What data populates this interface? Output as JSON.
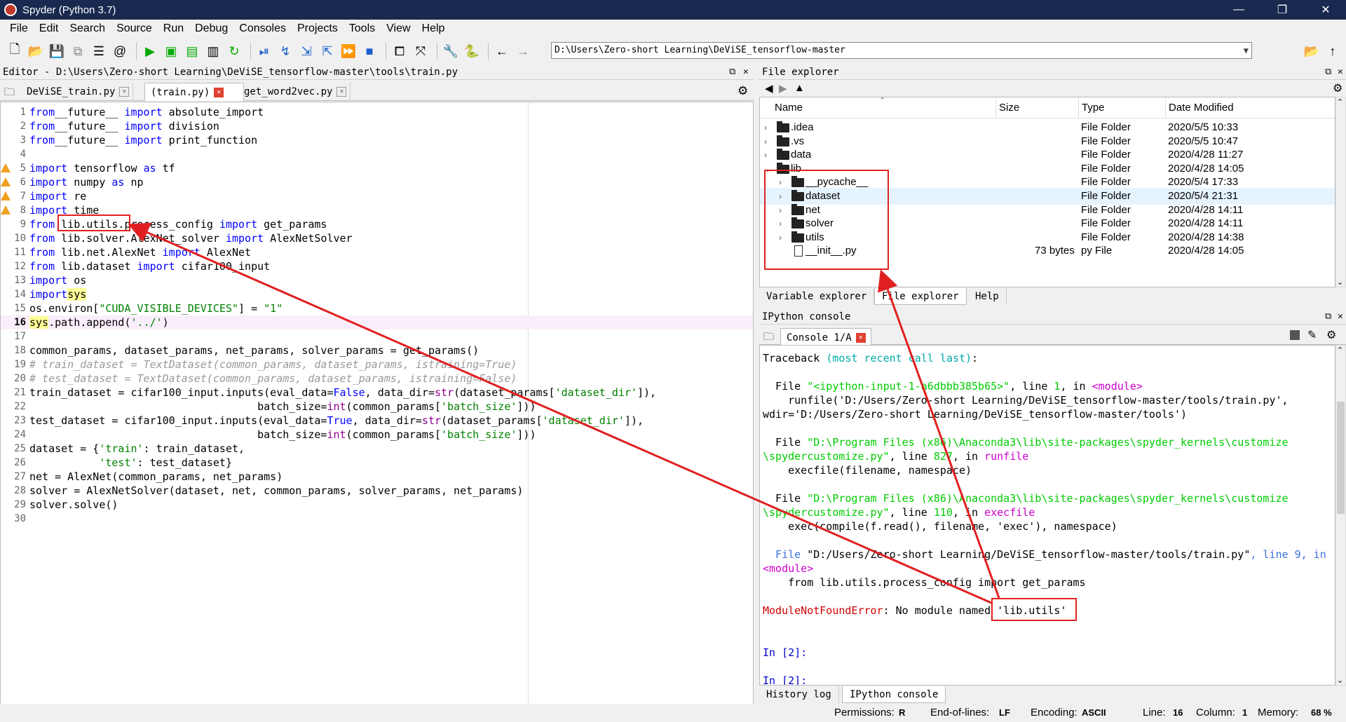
{
  "window": {
    "title": "Spyder (Python 3.7)",
    "minimize": "—",
    "maximize": "❐",
    "close": "✕"
  },
  "menu": [
    "File",
    "Edit",
    "Search",
    "Source",
    "Run",
    "Debug",
    "Consoles",
    "Projects",
    "Tools",
    "View",
    "Help"
  ],
  "toolbar": {
    "path": "D:\\Users\\Zero-short Learning\\DeViSE_tensorflow-master",
    "icons": [
      "new-file-icon",
      "open-folder-icon",
      "save-icon",
      "save-all-icon",
      "list-icon",
      "at-icon",
      "run-icon",
      "run-cell-icon",
      "run-cell-advance-icon",
      "run-selection-icon",
      "rerun-icon",
      "debug-icon",
      "step-icon",
      "step-into-icon",
      "step-return-icon",
      "continue-icon",
      "stop-icon",
      "maximize-pane-icon",
      "fullscreen-icon",
      "preferences-icon",
      "python-path-icon",
      "back-icon",
      "forward-icon",
      "browse-icon",
      "parent-dir-icon"
    ]
  },
  "editor": {
    "header": "Editor - D:\\Users\\Zero-short Learning\\DeViSE_tensorflow-master\\tools\\train.py",
    "tabs": [
      {
        "label": "DeViSE_train.py",
        "close": "✕"
      },
      {
        "label": "(train.py)",
        "close": "✕"
      },
      {
        "label": "get_word2vec.py",
        "close": "✕"
      }
    ],
    "lines": [
      {
        "n": "1",
        "tokens": [
          [
            "kw",
            "from"
          ],
          [
            "",
            "__future__ "
          ],
          [
            "kw",
            "import"
          ],
          [
            "",
            " absolute_import"
          ]
        ]
      },
      {
        "n": "2",
        "tokens": [
          [
            "kw",
            "from"
          ],
          [
            "",
            "__future__ "
          ],
          [
            "kw",
            "import"
          ],
          [
            "",
            " division"
          ]
        ]
      },
      {
        "n": "3",
        "tokens": [
          [
            "kw",
            "from"
          ],
          [
            "",
            "__future__ "
          ],
          [
            "kw",
            "import"
          ],
          [
            "",
            " print_function"
          ]
        ]
      },
      {
        "n": "4",
        "tokens": []
      },
      {
        "n": "5",
        "warn": true,
        "tokens": [
          [
            "kw",
            "import"
          ],
          [
            "",
            " tensorflow "
          ],
          [
            "kw",
            "as"
          ],
          [
            "",
            " tf"
          ]
        ]
      },
      {
        "n": "6",
        "warn": true,
        "tokens": [
          [
            "kw",
            "import"
          ],
          [
            "",
            " numpy "
          ],
          [
            "kw",
            "as"
          ],
          [
            "",
            " np"
          ]
        ]
      },
      {
        "n": "7",
        "warn": true,
        "tokens": [
          [
            "kw",
            "import"
          ],
          [
            "",
            " re"
          ]
        ]
      },
      {
        "n": "8",
        "warn": true,
        "tokens": [
          [
            "kw",
            "import"
          ],
          [
            "",
            " time"
          ]
        ]
      },
      {
        "n": "9",
        "tokens": [
          [
            "kw",
            "from"
          ],
          [
            "",
            " lib.utils.process_config "
          ],
          [
            "kw",
            "import"
          ],
          [
            "",
            " get_params"
          ]
        ]
      },
      {
        "n": "10",
        "tokens": [
          [
            "kw",
            "from"
          ],
          [
            "",
            " lib.solver.AlexNet_solver "
          ],
          [
            "kw",
            "import"
          ],
          [
            "",
            " AlexNetSolver"
          ]
        ]
      },
      {
        "n": "11",
        "tokens": [
          [
            "kw",
            "from"
          ],
          [
            "",
            " lib.net.AlexNet "
          ],
          [
            "kw",
            "import"
          ],
          [
            "",
            " AlexNet"
          ]
        ]
      },
      {
        "n": "12",
        "tokens": [
          [
            "kw",
            "from"
          ],
          [
            "",
            " lib.dataset "
          ],
          [
            "kw",
            "import"
          ],
          [
            "",
            " cifar100_input"
          ]
        ]
      },
      {
        "n": "13",
        "tokens": [
          [
            "kw",
            "import"
          ],
          [
            "",
            " os"
          ]
        ]
      },
      {
        "n": "14",
        "tokens": [
          [
            "kw",
            "import"
          ],
          [
            " ",
            ""
          ],
          [
            "hl",
            "sys"
          ]
        ]
      },
      {
        "n": "15",
        "tokens": [
          [
            "",
            "os.environ["
          ],
          [
            "str",
            "\"CUDA_VISIBLE_DEVICES\""
          ],
          [
            "",
            "] = "
          ],
          [
            "str",
            "\"1\""
          ]
        ]
      },
      {
        "n": "16",
        "cur": true,
        "tokens": [
          [
            "hl",
            "sys"
          ],
          [
            "",
            ".path.append("
          ],
          [
            "str",
            "'../'"
          ],
          [
            "",
            ")"
          ]
        ]
      },
      {
        "n": "17",
        "tokens": []
      },
      {
        "n": "18",
        "tokens": [
          [
            "",
            "common_params, dataset_params, net_params, solver_params = get_params()"
          ]
        ]
      },
      {
        "n": "19",
        "tokens": [
          [
            "cm",
            "# train_dataset = TextDataset(common_params, dataset_params, istraining=True)"
          ]
        ]
      },
      {
        "n": "20",
        "tokens": [
          [
            "cm",
            "# test_dataset = TextDataset(common_params, dataset_params, istraining=False)"
          ]
        ]
      },
      {
        "n": "21",
        "tokens": [
          [
            "",
            "train_dataset = cifar100_input.inputs(eval_data="
          ],
          [
            "kw",
            "False"
          ],
          [
            "",
            ", data_dir="
          ],
          [
            "bi",
            "str"
          ],
          [
            "",
            "(dataset_params["
          ],
          [
            "str",
            "'dataset_dir'"
          ],
          [
            "",
            "]),"
          ]
        ]
      },
      {
        "n": "22",
        "tokens": [
          [
            "",
            "                                    batch_size="
          ],
          [
            "bi",
            "int"
          ],
          [
            "",
            "(common_params["
          ],
          [
            "str",
            "'batch_size'"
          ],
          [
            "",
            "]))"
          ]
        ]
      },
      {
        "n": "23",
        "tokens": [
          [
            "",
            "test_dataset = cifar100_input.inputs(eval_data="
          ],
          [
            "kw",
            "True"
          ],
          [
            "",
            ", data_dir="
          ],
          [
            "bi",
            "str"
          ],
          [
            "",
            "(dataset_params["
          ],
          [
            "str",
            "'dataset_dir'"
          ],
          [
            "",
            "]),"
          ]
        ]
      },
      {
        "n": "24",
        "tokens": [
          [
            "",
            "                                    batch_size="
          ],
          [
            "bi",
            "int"
          ],
          [
            "",
            "(common_params["
          ],
          [
            "str",
            "'batch_size'"
          ],
          [
            "",
            "]))"
          ]
        ]
      },
      {
        "n": "25",
        "tokens": [
          [
            "",
            "dataset = {"
          ],
          [
            "str",
            "'train'"
          ],
          [
            "",
            ": train_dataset,"
          ]
        ]
      },
      {
        "n": "26",
        "tokens": [
          [
            "",
            "           "
          ],
          [
            "str",
            "'test'"
          ],
          [
            "",
            ": test_dataset}"
          ]
        ]
      },
      {
        "n": "27",
        "tokens": [
          [
            "",
            "net = AlexNet(common_params, net_params)"
          ]
        ]
      },
      {
        "n": "28",
        "tokens": [
          [
            "",
            "solver = AlexNetSolver(dataset, net, common_params, solver_params, net_params)"
          ]
        ]
      },
      {
        "n": "29",
        "tokens": [
          [
            "",
            "solver.solve()"
          ]
        ]
      },
      {
        "n": "30",
        "tokens": []
      }
    ]
  },
  "file_explorer": {
    "header": "File explorer",
    "columns": {
      "name": "Name",
      "size": "Size",
      "type": "Type",
      "modified": "Date Modified"
    },
    "rows": [
      {
        "name": ".idea",
        "size": "",
        "type": "File Folder",
        "modified": "2020/5/5 10:33",
        "depth": 0,
        "kind": "folder",
        "expanded": false
      },
      {
        "name": ".vs",
        "size": "",
        "type": "File Folder",
        "modified": "2020/5/5 10:47",
        "depth": 0,
        "kind": "folder",
        "expanded": false
      },
      {
        "name": "data",
        "size": "",
        "type": "File Folder",
        "modified": "2020/4/28 11:27",
        "depth": 0,
        "kind": "folder",
        "expanded": false
      },
      {
        "name": "lib",
        "size": "",
        "type": "File Folder",
        "modified": "2020/4/28 14:05",
        "depth": 0,
        "kind": "folder",
        "expanded": true
      },
      {
        "name": "__pycache__",
        "size": "",
        "type": "File Folder",
        "modified": "2020/5/4 17:33",
        "depth": 1,
        "kind": "folder",
        "expanded": false
      },
      {
        "name": "dataset",
        "size": "",
        "type": "File Folder",
        "modified": "2020/5/4 21:31",
        "depth": 1,
        "kind": "folder",
        "expanded": false,
        "selected": true
      },
      {
        "name": "net",
        "size": "",
        "type": "File Folder",
        "modified": "2020/4/28 14:11",
        "depth": 1,
        "kind": "folder",
        "expanded": false
      },
      {
        "name": "solver",
        "size": "",
        "type": "File Folder",
        "modified": "2020/4/28 14:11",
        "depth": 1,
        "kind": "folder",
        "expanded": false
      },
      {
        "name": "utils",
        "size": "",
        "type": "File Folder",
        "modified": "2020/4/28 14:38",
        "depth": 1,
        "kind": "folder",
        "expanded": false
      },
      {
        "name": "__init__.py",
        "size": "73 bytes",
        "type": "py File",
        "modified": "2020/4/28 14:05",
        "depth": 1,
        "kind": "file",
        "expanded": false
      }
    ],
    "bottom_tabs": [
      "Variable explorer",
      "File explorer",
      "Help"
    ]
  },
  "console": {
    "header": "IPython console",
    "tab": "Console 1/A",
    "bottom_tabs": [
      "History log",
      "IPython console"
    ],
    "lines": [
      {
        "y": 0,
        "tokens": [
          [
            "",
            "Traceback "
          ],
          [
            "cyan",
            "(most recent call last)"
          ],
          [
            "",
            ":"
          ]
        ]
      },
      {
        "y": 2,
        "tokens": [
          [
            "",
            "  File "
          ],
          [
            "grn",
            "\"<ipython-input-1-a6dbbb385b65>\""
          ],
          [
            "",
            ", line "
          ],
          [
            "grn",
            "1"
          ],
          [
            "",
            ", in "
          ],
          [
            "mag",
            "<module>"
          ]
        ]
      },
      {
        "y": 3,
        "tokens": [
          [
            "",
            "    runfile('D:/Users/Zero-short Learning/DeViSE_tensorflow-master/tools/train.py',"
          ]
        ]
      },
      {
        "y": 4,
        "tokens": [
          [
            "",
            "wdir='D:/Users/Zero-short Learning/DeViSE_tensorflow-master/tools')"
          ]
        ]
      },
      {
        "y": 6,
        "tokens": [
          [
            "",
            "  File "
          ],
          [
            "grn",
            "\"D:\\Program Files (x86)\\Anaconda3\\lib\\site-packages\\spyder_kernels\\customize"
          ]
        ]
      },
      {
        "y": 7,
        "tokens": [
          [
            "grn",
            "\\spydercustomize.py\""
          ],
          [
            "",
            ", line "
          ],
          [
            "grn",
            "827"
          ],
          [
            "",
            ", in "
          ],
          [
            "mag",
            "runfile"
          ]
        ]
      },
      {
        "y": 8,
        "tokens": [
          [
            "",
            "    execfile(filename, namespace)"
          ]
        ]
      },
      {
        "y": 10,
        "tokens": [
          [
            "",
            "  File "
          ],
          [
            "grn",
            "\"D:\\Program Files (x86)\\Anaconda3\\lib\\site-packages\\spyder_kernels\\customize"
          ]
        ]
      },
      {
        "y": 11,
        "tokens": [
          [
            "grn",
            "\\spydercustomize.py\""
          ],
          [
            "",
            ", line "
          ],
          [
            "grn",
            "110"
          ],
          [
            "",
            ", in "
          ],
          [
            "mag",
            "execfile"
          ]
        ]
      },
      {
        "y": 12,
        "tokens": [
          [
            "",
            "    exec(compile(f.read(), filename, 'exec'), namespace)"
          ]
        ]
      },
      {
        "y": 14,
        "tokens": [
          [
            "blu",
            "  File "
          ],
          [
            "",
            "\"D:/Users/Zero-short Learning/DeViSE_tensorflow-master/tools/train.py\""
          ],
          [
            "blu",
            ", line 9, in"
          ]
        ]
      },
      {
        "y": 15,
        "tokens": [
          [
            "mag",
            "<module>"
          ]
        ]
      },
      {
        "y": 16,
        "tokens": [
          [
            "",
            "    from lib.utils.process_config import get_params"
          ]
        ]
      },
      {
        "y": 18,
        "tokens": [
          [
            "red",
            "ModuleNotFoundError"
          ],
          [
            "",
            ": No module named 'lib.utils'"
          ]
        ]
      },
      {
        "y": 21,
        "tokens": [
          [
            "prompt",
            "In [2]:"
          ]
        ]
      },
      {
        "y": 23,
        "tokens": [
          [
            "prompt",
            "In [2]:"
          ]
        ]
      }
    ]
  },
  "statusbar": {
    "permissions_label": "Permissions:",
    "permissions": "R",
    "eol_label": "End-of-lines:",
    "eol": "LF",
    "encoding_label": "Encoding:",
    "encoding": "ASCII",
    "line_label": "Line:",
    "line": "16",
    "column_label": "Column:",
    "column": "1",
    "memory_label": "Memory:",
    "memory": "68 %"
  },
  "colors": {
    "titlebar": "#19294f",
    "annotation": "#e02020",
    "keyword": "#0000ff",
    "string": "#008000"
  }
}
